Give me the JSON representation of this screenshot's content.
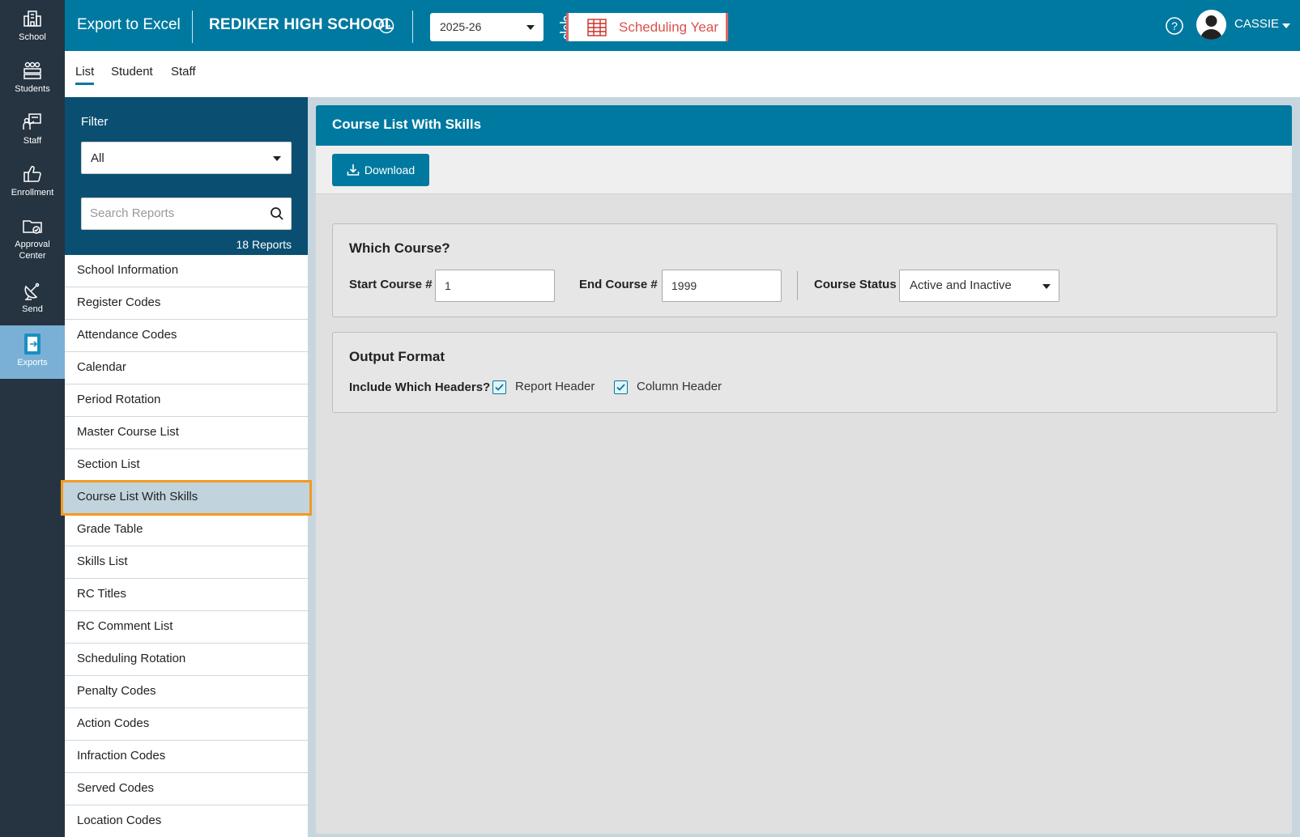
{
  "rail": {
    "items": [
      {
        "label": "School",
        "icon": "school-icon"
      },
      {
        "label": "Students",
        "icon": "students-icon"
      },
      {
        "label": "Staff",
        "icon": "staff-icon"
      },
      {
        "label": "Enrollment",
        "icon": "thumbs-up-icon"
      },
      {
        "label": "Approval Center",
        "icon": "folder-check-icon"
      },
      {
        "label": "Send",
        "icon": "satellite-dish-icon"
      },
      {
        "label": "Exports",
        "icon": "export-file-icon",
        "active": true
      }
    ]
  },
  "header": {
    "app_title": "Export to Excel",
    "school_name": "REDIKER HIGH SCHOOL",
    "year": "2025-26",
    "scheduling_badge": "Scheduling Year",
    "user_name": "CASSIE"
  },
  "subnav": {
    "tabs": [
      {
        "label": "List",
        "active": true
      },
      {
        "label": "Student"
      },
      {
        "label": "Staff"
      }
    ]
  },
  "sidebar": {
    "filter_label": "Filter",
    "filter_value": "All",
    "search_placeholder": "Search Reports",
    "count": "18 Reports",
    "items": [
      "School Information",
      "Register Codes",
      "Attendance Codes",
      "Calendar",
      "Period Rotation",
      "Master Course List",
      "Section List",
      "Course List With Skills",
      "Grade Table",
      "Skills List",
      "RC Titles",
      "RC Comment List",
      "Scheduling Rotation",
      "Penalty Codes",
      "Action Codes",
      "Infraction Codes",
      "Served Codes",
      "Location Codes"
    ],
    "selected_index": 7
  },
  "main": {
    "title": "Course List With Skills",
    "download_label": "Download",
    "which_course": {
      "title": "Which Course?",
      "start_label": "Start Course #",
      "start_value": "1",
      "end_label": "End Course #",
      "end_value": "1999",
      "status_label": "Course Status",
      "status_value": "Active and Inactive"
    },
    "output_format": {
      "title": "Output Format",
      "headers_label": "Include Which Headers?",
      "report_header": "Report Header",
      "report_header_checked": true,
      "column_header": "Column Header",
      "column_header_checked": true
    }
  },
  "colors": {
    "topbar": "#0079a0",
    "rail": "#263441",
    "sidebar_head": "#0a4f72",
    "selected_outline": "#f39a1e",
    "badge_red": "#d9534f"
  }
}
